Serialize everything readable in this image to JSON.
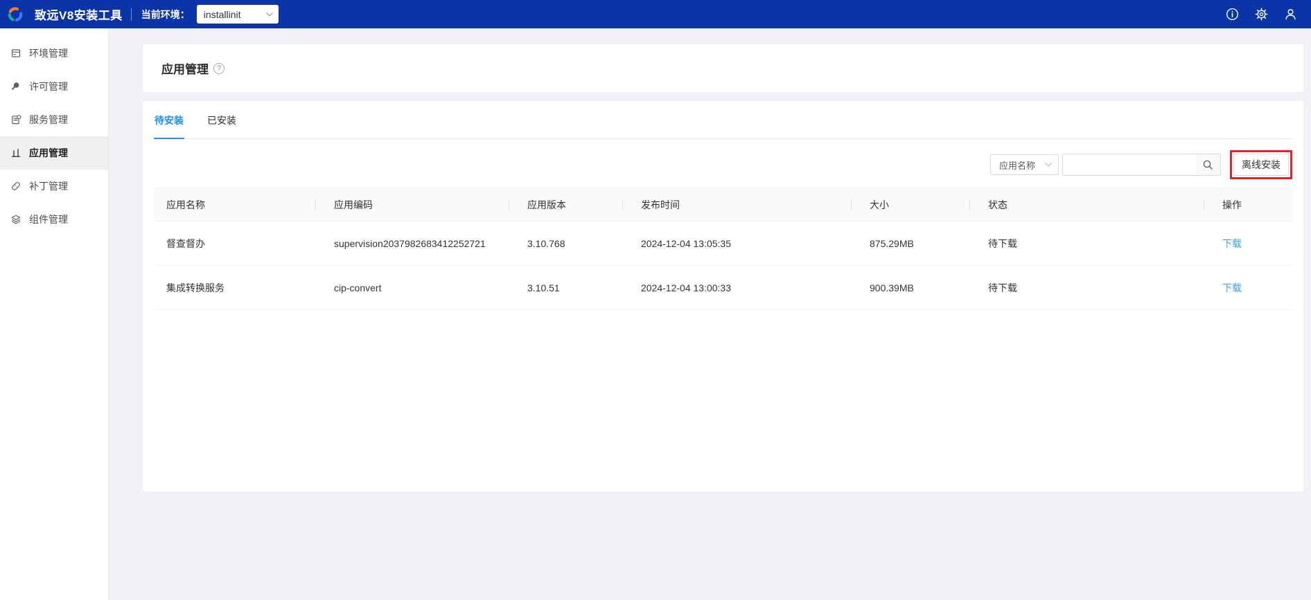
{
  "topbar": {
    "app_title": "致远V8安装工具",
    "env_label": "当前环境：",
    "env_value": "installinit"
  },
  "sidebar": {
    "items": [
      {
        "label": "环境管理",
        "icon": "environment-icon"
      },
      {
        "label": "许可管理",
        "icon": "license-icon"
      },
      {
        "label": "服务管理",
        "icon": "service-icon"
      },
      {
        "label": "应用管理",
        "icon": "application-icon",
        "active": true
      },
      {
        "label": "补丁管理",
        "icon": "patch-icon"
      },
      {
        "label": "组件管理",
        "icon": "component-icon"
      }
    ]
  },
  "page": {
    "title": "应用管理",
    "help_glyph": "?"
  },
  "tabs": {
    "items": [
      {
        "label": "待安装",
        "active": true
      },
      {
        "label": "已安装",
        "active": false
      }
    ]
  },
  "toolbar": {
    "filter_value": "应用名称",
    "search_value": "",
    "search_placeholder": "",
    "offline_install_label": "离线安装"
  },
  "table": {
    "columns": [
      "应用名称",
      "应用编码",
      "应用版本",
      "发布时间",
      "大小",
      "状态",
      "操作"
    ],
    "rows": [
      {
        "name": "督查督办",
        "code": "supervision2037982683412252721",
        "version": "3.10.768",
        "published": "2024-12-04 13:05:35",
        "size": "875.29MB",
        "status": "待下载",
        "action": "下载"
      },
      {
        "name": "集成转换服务",
        "code": "cip-convert",
        "version": "3.10.51",
        "published": "2024-12-04 13:00:33",
        "size": "900.39MB",
        "status": "待下载",
        "action": "下载"
      }
    ]
  },
  "colors": {
    "topbar": "#0c34a9",
    "accent": "#1890ff",
    "link": "#3d9eff",
    "annotation": "#e8222d",
    "page_background": "#f0f2f5"
  }
}
